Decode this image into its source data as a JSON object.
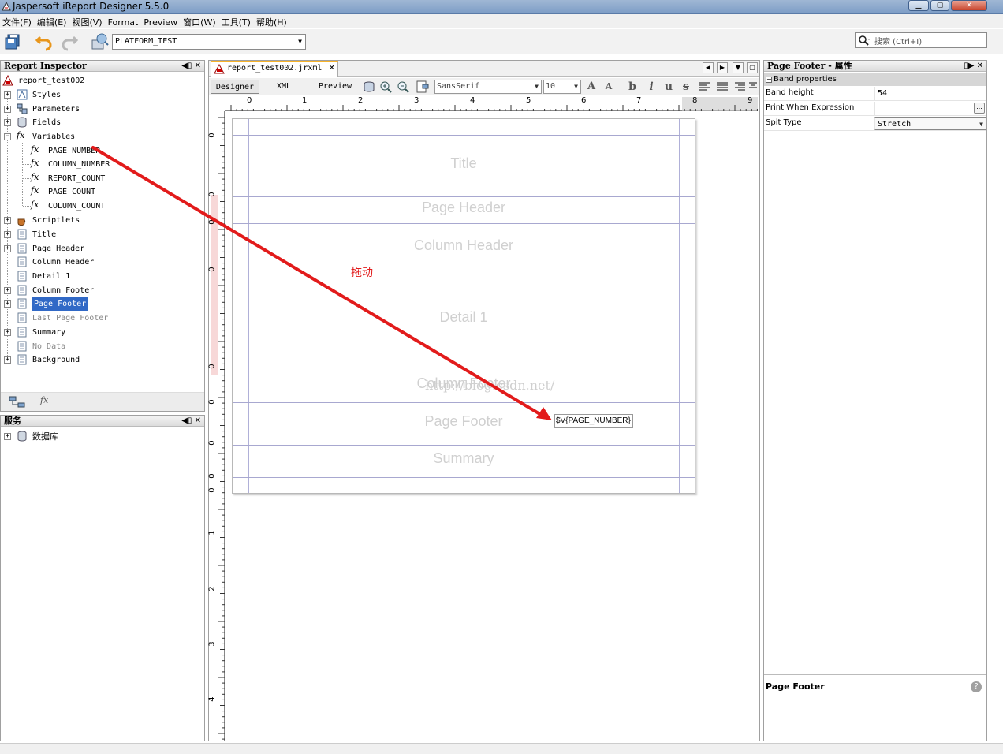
{
  "window": {
    "title": "Jaspersoft iReport Designer 5.5.0"
  },
  "menu": [
    "文件(F)",
    "编辑(E)",
    "视图(V)",
    "Format",
    "Preview",
    "窗口(W)",
    "工具(T)",
    "帮助(H)"
  ],
  "toolbar": {
    "connection": "PLATFORM_TEST",
    "search_placeholder": "搜索 (Ctrl+I)"
  },
  "inspector": {
    "title": "Report Inspector",
    "root": "report_test002",
    "nodes": {
      "styles": "Styles",
      "parameters": "Parameters",
      "fields": "Fields",
      "variables": "Variables",
      "scriptlets": "Scriptlets",
      "title": "Title",
      "page_header": "Page Header",
      "column_header": "Column Header",
      "detail": "Detail 1",
      "column_footer": "Column Footer",
      "page_footer": "Page Footer",
      "last_page_footer": "Last Page Footer",
      "summary": "Summary",
      "no_data": "No Data",
      "background": "Background"
    },
    "variables": [
      "PAGE_NUMBER",
      "COLUMN_NUMBER",
      "REPORT_COUNT",
      "PAGE_COUNT",
      "COLUMN_COUNT"
    ]
  },
  "services": {
    "title": "服务",
    "items": [
      "数据库"
    ]
  },
  "editor": {
    "tab": "report_test002.jrxml",
    "modes": [
      "Designer",
      "XML",
      "Preview"
    ],
    "font": "SansSerif",
    "size": "10",
    "ruler_h": [
      "0",
      "1",
      "2",
      "3",
      "4",
      "5",
      "6",
      "7",
      "8",
      "9"
    ],
    "ruler_v": [
      "0",
      "0",
      "0",
      "0",
      "0",
      "0",
      "0",
      "0",
      "0",
      "1",
      "2",
      "3",
      "4"
    ],
    "bands": {
      "title": "Title",
      "page_header": "Page Header",
      "column_header": "Column Header",
      "detail": "Detail 1",
      "column_footer": "Column Footer",
      "page_footer": "Page Footer",
      "summary": "Summary"
    },
    "field_expression": "$V{PAGE_NUMBER}",
    "watermark": "http://blog.csdn.net/",
    "annotation": "拖动"
  },
  "properties": {
    "title": "Page Footer - 属性",
    "category": "Band properties",
    "rows": [
      {
        "name": "Band height",
        "value": "54"
      },
      {
        "name": "Print When Expression",
        "value": ""
      },
      {
        "name": "Spit Type",
        "value": "Stretch"
      }
    ],
    "description_title": "Page Footer"
  },
  "colors": {
    "accent": "#3169c6",
    "annotation": "#e21b1b",
    "tab_highlight": "#f7b32b"
  }
}
